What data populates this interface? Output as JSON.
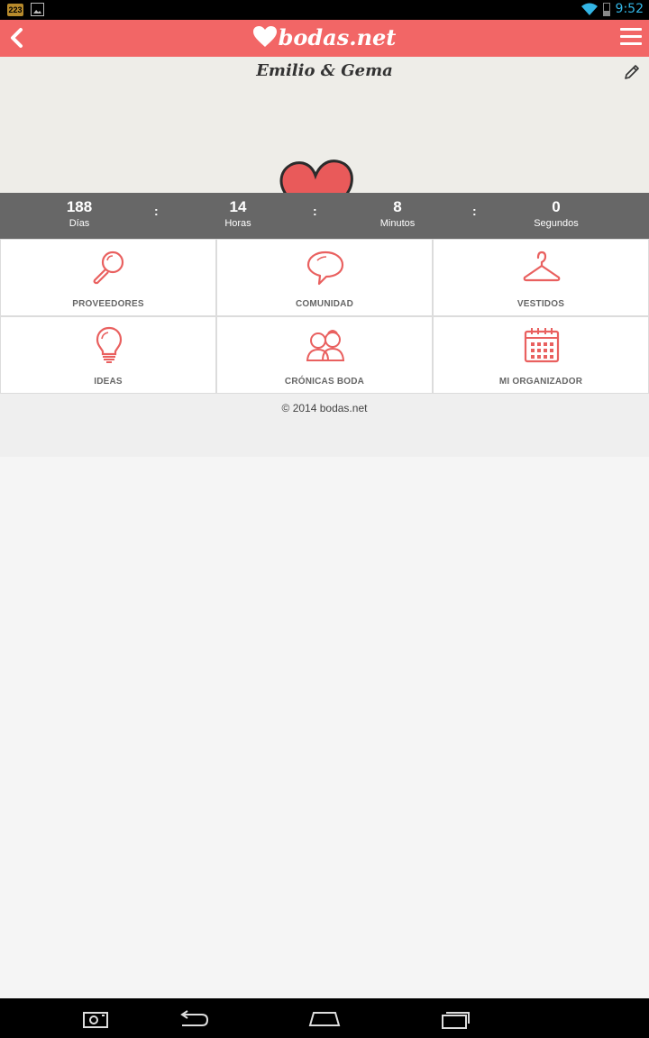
{
  "status_bar": {
    "time": "9:52",
    "notification_badge": "223"
  },
  "app_bar": {
    "logo_text": "bodas.net",
    "back_icon": "chevron-left-icon",
    "menu_icon": "hamburger-menu-icon"
  },
  "banner": {
    "couple_name": "Emilio & Gema",
    "edit_icon": "pencil-icon"
  },
  "countdown": {
    "days": {
      "value": "188",
      "label": "Días"
    },
    "hours": {
      "value": "14",
      "label": "Horas"
    },
    "minutes": {
      "value": "8",
      "label": "Minutos"
    },
    "seconds": {
      "value": "0",
      "label": "Segundos"
    },
    "separator": ":"
  },
  "tiles": [
    {
      "label": "PROVEEDORES",
      "icon": "magnifier-icon"
    },
    {
      "label": "COMUNIDAD",
      "icon": "speech-bubble-icon"
    },
    {
      "label": "VESTIDOS",
      "icon": "hanger-icon"
    },
    {
      "label": "IDEAS",
      "icon": "lightbulb-icon"
    },
    {
      "label": "CRÓNICAS BODA",
      "icon": "couple-icon"
    },
    {
      "label": "MI ORGANIZADOR",
      "icon": "calendar-icon"
    }
  ],
  "footer": {
    "copyright": "© 2014 bodas.net"
  },
  "colors": {
    "brand": "#f26666",
    "icon_accent": "#e9605f",
    "countdown_bg": "#676767"
  }
}
